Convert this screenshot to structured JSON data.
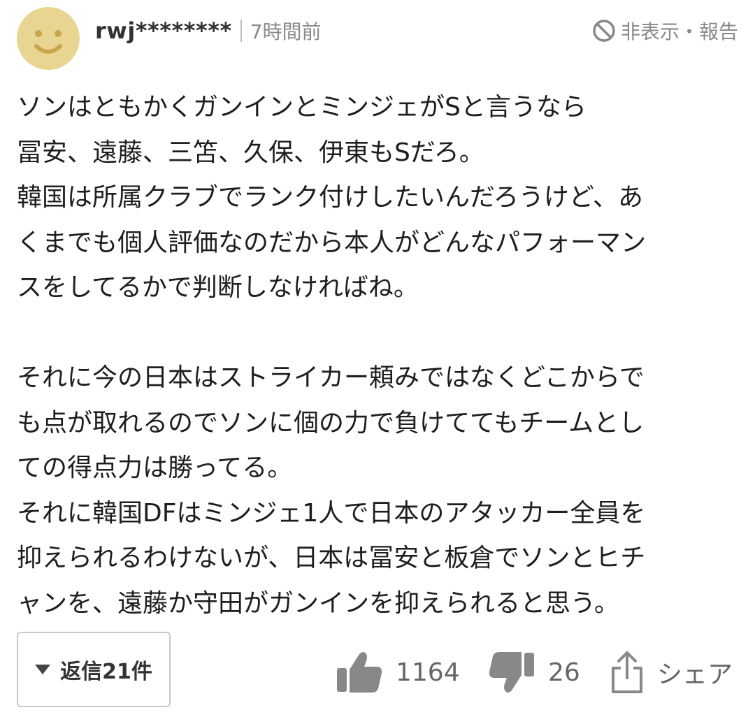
{
  "comment": {
    "username": "rwj********",
    "time": "7時間前",
    "report_label": "非表示・報告",
    "body_lines": [
      "ソンはともかくガンインとミンジェがSと言うなら",
      "冨安、遠藤、三笘、久保、伊東もSだろ。",
      "韓国は所属クラブでランク付けしたいんだろうけど、あ",
      "くまでも個人評価なのだから本人がどんなパフォーマン",
      "スをしてるかで判断しなければね。",
      "",
      "それに今の日本はストライカー頼みではなくどこからで",
      "も点が取れるのでソンに個の力で負けててもチームとし",
      "ての得点力は勝ってる。",
      "それに韓国DFはミンジェ1人で日本のアタッカー全員を",
      "抑えられるわけないが、日本は冨安と板倉でソンとヒチ",
      "ャンを、遠藤か守田がガンインを抑えられると思う。"
    ]
  },
  "footer": {
    "reply_label": "返信21件",
    "like_count": "1164",
    "dislike_count": "26",
    "share_label": "シェア"
  },
  "colors": {
    "avatar_bg": "#e8d592",
    "avatar_face": "#c9a64a",
    "icon_gray": "#888888"
  }
}
